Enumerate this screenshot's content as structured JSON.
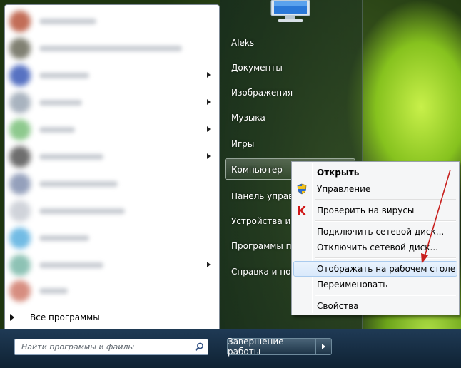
{
  "start_menu": {
    "all_programs_label": "Все программы",
    "search": {
      "placeholder": "Найти программы и файлы",
      "value": ""
    },
    "user_name": "Aleks",
    "places": [
      {
        "label": "Aleks"
      },
      {
        "label": "Документы"
      },
      {
        "label": "Изображения"
      },
      {
        "label": "Музыка"
      },
      {
        "label": "Игры"
      },
      {
        "label": "Компьютер"
      },
      {
        "label": "Панель управл"
      },
      {
        "label": "Устройства и пр"
      },
      {
        "label": "Программы по"
      },
      {
        "label": "Справка и подд"
      }
    ],
    "shutdown_label": "Завершение работы"
  },
  "context_menu": {
    "items": [
      {
        "label": "Открыть"
      },
      {
        "label": "Управление"
      },
      {
        "label": "Проверить на вирусы"
      },
      {
        "label": "Подключить сетевой диск..."
      },
      {
        "label": "Отключить сетевой диск..."
      },
      {
        "label": "Отображать на рабочем столе"
      },
      {
        "label": "Переименовать"
      },
      {
        "label": "Свойства"
      }
    ]
  },
  "colors": {
    "annotation": "#c8201e",
    "highlight": "#d9e9fb"
  }
}
